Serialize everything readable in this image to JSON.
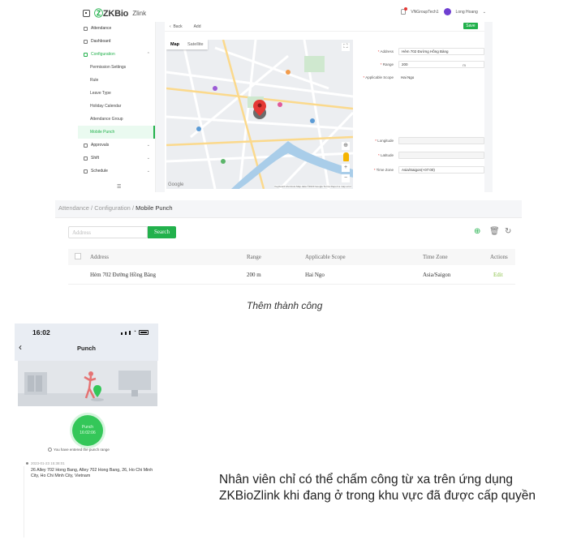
{
  "app": {
    "logo_text": "ZKBio",
    "logo_sub": "Zlink",
    "company": "VNGroupTech1",
    "user": "Long Hoang"
  },
  "sidebar": {
    "items": [
      {
        "label": "Attendance",
        "level": "top"
      },
      {
        "label": "Dashboard",
        "level": "top"
      },
      {
        "label": "Configuration",
        "level": "top",
        "state": "expanded"
      },
      {
        "label": "Permission Settings",
        "level": "sub"
      },
      {
        "label": "Rule",
        "level": "sub"
      },
      {
        "label": "Leave Type",
        "level": "sub"
      },
      {
        "label": "Holiday Calendar",
        "level": "sub"
      },
      {
        "label": "Attendance Group",
        "level": "sub"
      },
      {
        "label": "Mobile Punch",
        "level": "sub",
        "state": "active"
      },
      {
        "label": "Approvals",
        "level": "top"
      },
      {
        "label": "Shift",
        "level": "top"
      },
      {
        "label": "Schedule",
        "level": "top"
      }
    ],
    "collapse_icon": "menu-icon"
  },
  "toolbar": {
    "back_label": "Back",
    "add_label": "Add",
    "save_label": "Save"
  },
  "map": {
    "tab_map": "Map",
    "tab_satellite": "Satellite",
    "attribution": "Keyboard shortcuts   Map data ©2023 Google   Terms   Report a map error",
    "brand": "Google"
  },
  "form": {
    "address_label": "Address",
    "address_value": "Hẻm 702 Đường Hồng Bàng",
    "range_label": "Range",
    "range_value": "200",
    "range_unit": "m",
    "scope_label": "Applicable Scope",
    "scope_value": "Hai Ngo",
    "longitude_label": "Longitude",
    "latitude_label": "Latitude",
    "timezone_label": "Time Zone",
    "timezone_value": "Asia/Saigon(+07:00)"
  },
  "list": {
    "breadcrumbs": [
      "Attendance",
      "/",
      "Configuration",
      "/",
      "Mobile Punch"
    ],
    "filter_placeholder": "Address",
    "search_label": "Search",
    "columns": [
      "Address",
      "Range",
      "Applicable Scope",
      "Time Zone",
      "Actions"
    ],
    "rows": [
      {
        "address": "Hẻm 702 Đường Hồng Bàng",
        "range": "200 m",
        "scope": "Hai Ngo",
        "timezone": "Asia/Saigon",
        "action": "Edit"
      }
    ],
    "tool_icons": [
      "add-icon",
      "delete-icon",
      "refresh-icon"
    ]
  },
  "caption_success": "Thêm thành công",
  "phone": {
    "time": "16:02",
    "title": "Punch",
    "punch_label": "Punch",
    "punch_time": "16:02:06",
    "range_message": "You have entered the punch range",
    "record_time": "2023-01-23 15:38:01",
    "record_address": "26 Alley 702 Hong Bang, Alley 702 Hong Bang, 26, Ho Chi Minh City, Ho Chi Minh City, Vietnam"
  },
  "caption_note": "Nhân viên chỉ có thể chấm công từ xa trên ứng dụng ZKBioZlink khi đang ở trong khu vực đã được cấp quyền",
  "colors": {
    "accent": "#22b14c",
    "punch_green": "#34c759"
  }
}
